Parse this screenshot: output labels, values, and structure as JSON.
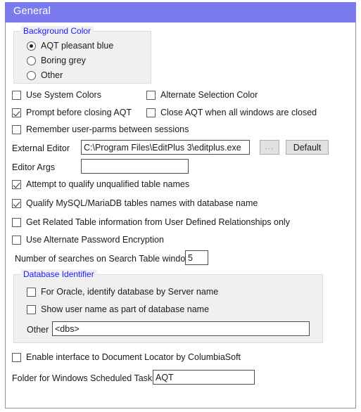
{
  "window": {
    "title": "General",
    "title_bar_color": "#7b7bee",
    "panel_border_color": "#7f9aa3"
  },
  "background_color_group": {
    "legend": "Background Color",
    "legend_color": "#1a1aff",
    "options": [
      {
        "label": "AQT pleasant blue",
        "checked": true
      },
      {
        "label": "Boring grey",
        "checked": false
      },
      {
        "label": "Other",
        "checked": false
      }
    ]
  },
  "checkboxes": {
    "use_system_colors": {
      "label": "Use System Colors",
      "checked": false
    },
    "alternate_selection_color": {
      "label": "Alternate Selection Color",
      "checked": false
    },
    "prompt_before_closing": {
      "label": "Prompt before closing AQT",
      "checked": true
    },
    "close_aqt_all_windows": {
      "label": "Close AQT when all windows are closed",
      "checked": false
    },
    "remember_user_parms": {
      "label": "Remember user-parms between sessions",
      "checked": false
    },
    "attempt_qualify": {
      "label": "Attempt to qualify unqualified table names",
      "checked": true
    },
    "qualify_mysql": {
      "label": "Qualify MySQL/MariaDB tables names with database name",
      "checked": true
    },
    "get_related_table": {
      "label": "Get Related Table information from User Defined Relationships only",
      "checked": false
    },
    "use_alt_password_encryption": {
      "label": "Use Alternate Password Encryption",
      "checked": false
    },
    "enable_document_locator": {
      "label": "Enable interface to Document Locator by ColumbiaSoft",
      "checked": false
    }
  },
  "external_editor": {
    "label": "External Editor",
    "value": "C:\\Program Files\\EditPlus 3\\editplus.exe",
    "browse_button_label": "...",
    "default_button_label": "Default"
  },
  "editor_args": {
    "label": "Editor Args",
    "value": "",
    "placeholder": ""
  },
  "number_of_searches": {
    "label": "Number of searches on Search Table window",
    "value": "5"
  },
  "database_identifier_group": {
    "legend": "Database Identifier",
    "legend_color": "#1a1aff",
    "options": [
      {
        "label": "For Oracle, identify database by Server name",
        "checked": false
      },
      {
        "label": "Show user name as part of database name",
        "checked": false
      }
    ],
    "other_label": "Other",
    "other_value": "<dbs>"
  },
  "scheduled_tasks": {
    "label": "Folder for Windows Scheduled Tasks",
    "value": "AQT"
  }
}
